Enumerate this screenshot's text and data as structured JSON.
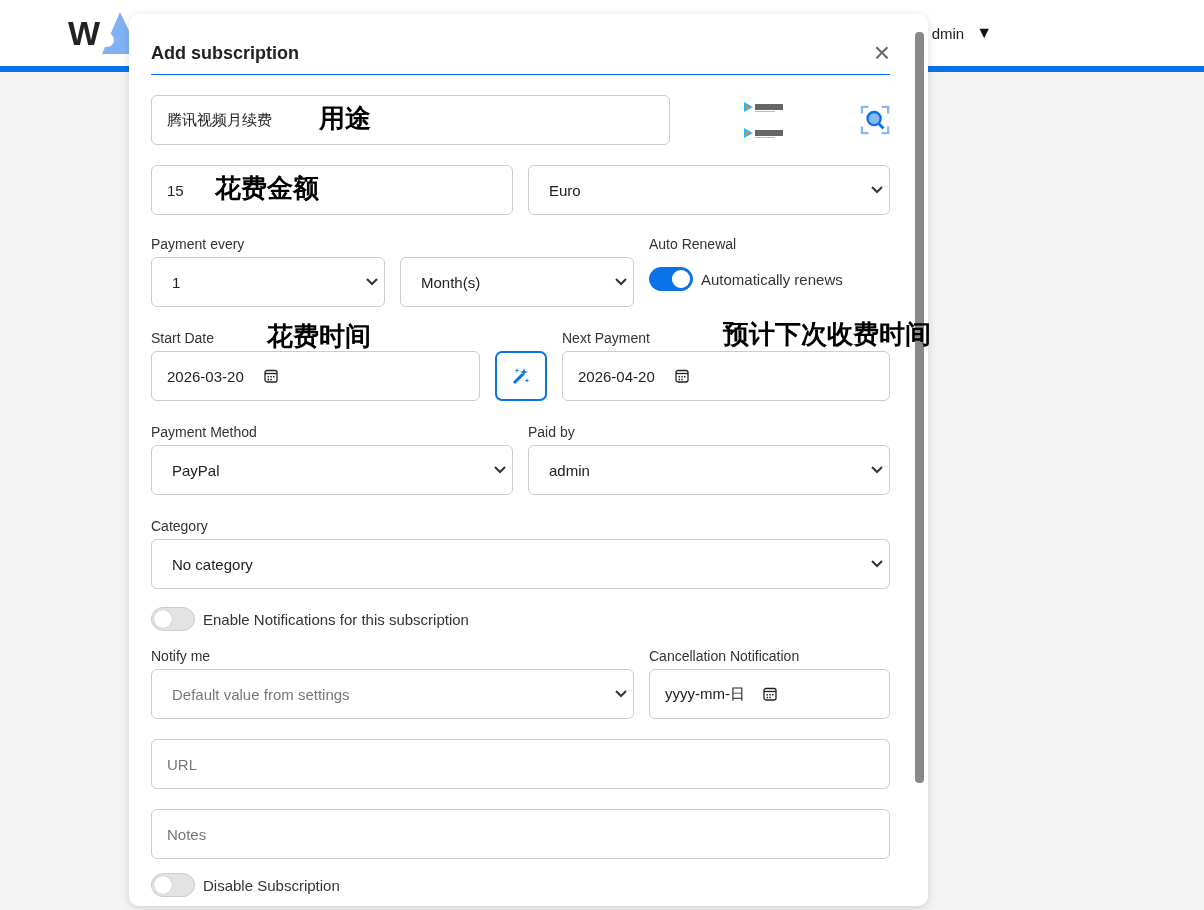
{
  "header": {
    "logo_letter": "W",
    "user": "dmin",
    "user_caret": "▼"
  },
  "modal": {
    "title": "Add subscription",
    "close": "×"
  },
  "name_field": {
    "value": "腾讯视频月续费",
    "annotation": "用途"
  },
  "amount_field": {
    "value": "15",
    "annotation": "花费金额"
  },
  "currency": {
    "value": "Euro"
  },
  "payment_every": {
    "label": "Payment every",
    "count": "1",
    "unit": "Month(s)"
  },
  "auto_renewal": {
    "label": "Auto Renewal",
    "text": "Automatically renews",
    "on": true
  },
  "start_date": {
    "label": "Start Date",
    "value": "2026-03-20",
    "annotation": "花费时间"
  },
  "next_payment": {
    "label": "Next Payment",
    "value": "2026-04-20",
    "annotation": "预计下次收费时间"
  },
  "payment_method": {
    "label": "Payment Method",
    "value": "PayPal"
  },
  "paid_by": {
    "label": "Paid by",
    "value": "admin"
  },
  "category": {
    "label": "Category",
    "value": "No category"
  },
  "notifications": {
    "text": "Enable Notifications for this subscription",
    "on": false
  },
  "notify_me": {
    "label": "Notify me",
    "value": "Default value from settings",
    "disabled": true
  },
  "cancellation": {
    "label": "Cancellation Notification",
    "placeholder": "yyyy-mm-日"
  },
  "url": {
    "placeholder": "URL"
  },
  "notes": {
    "placeholder": "Notes"
  },
  "disable_subscription": {
    "text": "Disable Subscription",
    "on": false
  }
}
